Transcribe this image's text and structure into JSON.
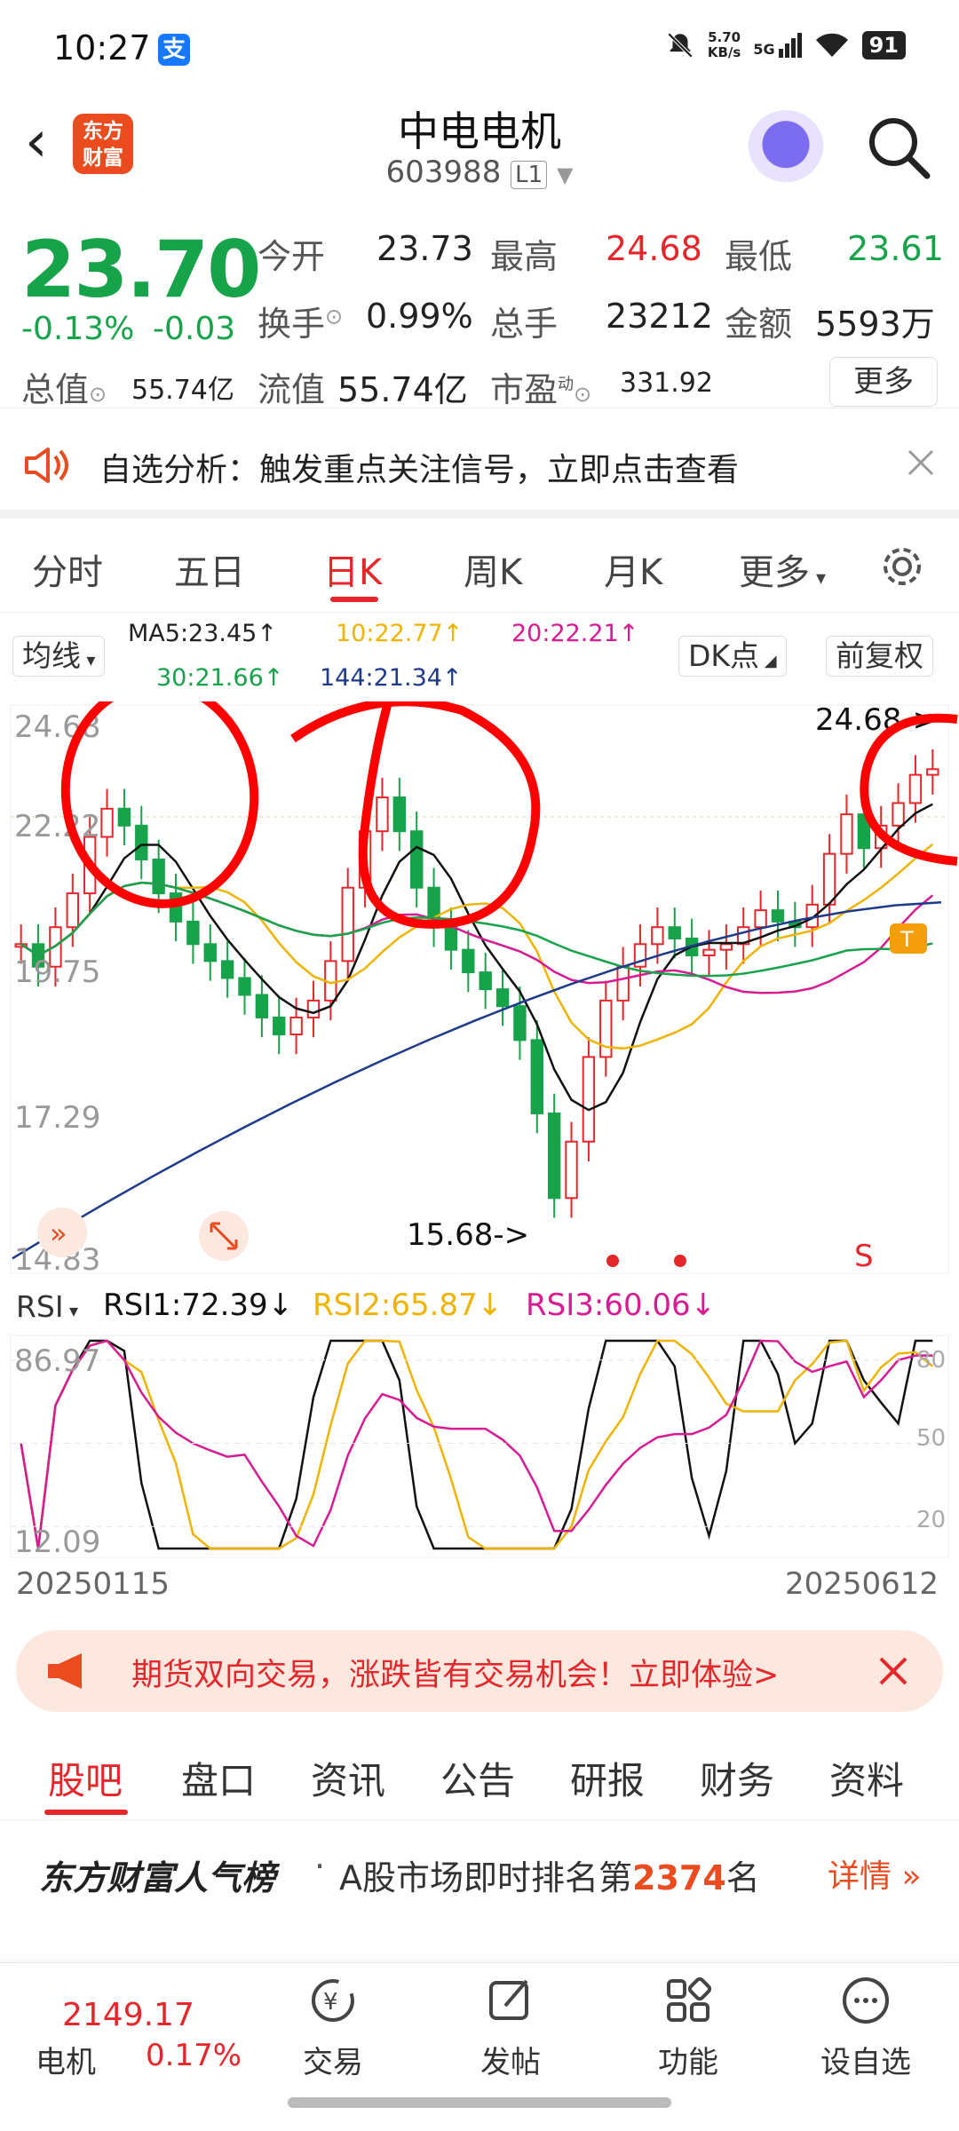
{
  "status_bar": {
    "time": "10:27",
    "alipay_icon": "支",
    "speed_value": "5.70",
    "speed_unit": "KB/s",
    "network": "5G",
    "battery": "91"
  },
  "header": {
    "logo_line1": "东方",
    "logo_line2": "财富",
    "stock_name": "中电电机",
    "stock_code": "603988",
    "level_badge": "L1"
  },
  "quote": {
    "price": "23.70",
    "change_pct": "-0.13%",
    "change_abs": "-0.03",
    "open_label": "今开",
    "open": "23.73",
    "high_label": "最高",
    "high": "24.68",
    "low_label": "最低",
    "low": "23.61",
    "turnover_label": "换手",
    "turnover": "0.99%",
    "volume_label": "总手",
    "volume": "23212",
    "amount_label": "金额",
    "amount": "5593万",
    "mktcap_label": "总值",
    "mktcap": "55.74亿",
    "float_label": "流值",
    "float_cap": "55.74亿",
    "pe_label": "市盈",
    "pe_sup": "动",
    "pe": "331.92",
    "more_button": "更多"
  },
  "banner": {
    "text": "自选分析：触发重点关注信号，立即点击查看"
  },
  "chart_tabs": [
    "分时",
    "五日",
    "日K",
    "周K",
    "月K",
    "更多"
  ],
  "chart_controls": {
    "ma_button": "均线",
    "ma5": "MA5:23.45↑",
    "ma10": "10:22.77↑",
    "ma20": "20:22.21↑",
    "ma30": "30:21.66↑",
    "ma144": "144:21.34↑",
    "dk_button": "DK点",
    "adjust_button": "前复权"
  },
  "kline_axis": {
    "y_labels": [
      "24.68",
      "22.22",
      "19.75",
      "17.29",
      "14.83"
    ],
    "high_marker": "24.68->",
    "low_marker": "15.68->",
    "signal": "S",
    "trade_badge": "T"
  },
  "rsi": {
    "selector": "RSI",
    "rsi1": "RSI1:72.39↓",
    "rsi2": "RSI2:65.87↓",
    "rsi3": "RSI3:60.06↓",
    "y_top": "86.97",
    "y_bottom": "12.09",
    "lvl80": "80",
    "lvl50": "50",
    "lvl20": "20"
  },
  "date_range": {
    "start": "20250115",
    "end": "20250612"
  },
  "ad": {
    "text": "期货双向交易，涨跌皆有交易机会！立即体验>"
  },
  "bottom_tabs": [
    "股吧",
    "盘口",
    "资讯",
    "公告",
    "研报",
    "财务",
    "资料"
  ],
  "rank": {
    "brand": "东方财富人气榜",
    "dot": "·",
    "prefix": "A股市场即时排名第",
    "number": "2374",
    "suffix": "名",
    "detail": "详情"
  },
  "bottom_nav": {
    "index_value": "2149.17",
    "index_name": "电机",
    "index_change": "0.17%",
    "trade": "交易",
    "post": "发帖",
    "functions": "功能",
    "add_watch": "设自选"
  },
  "chart_data": {
    "type": "candlestick",
    "x_start": "20250115",
    "x_end": "20250612",
    "y_range": [
      14.83,
      24.68
    ],
    "max_marked": 24.68,
    "min_marked": 15.68,
    "ma_latest": {
      "MA5": 23.45,
      "MA10": 22.77,
      "MA20": 22.21,
      "MA30": 21.66,
      "MA144": 21.34
    },
    "close_approx": [
      20.6,
      20.2,
      20.9,
      21.5,
      22.5,
      23.0,
      22.7,
      22.1,
      21.5,
      21.0,
      20.6,
      20.3,
      20.0,
      19.7,
      19.3,
      19.0,
      19.3,
      19.6,
      20.3,
      21.6,
      22.6,
      23.2,
      22.6,
      21.6,
      20.9,
      20.5,
      20.1,
      19.8,
      19.5,
      18.9,
      17.6,
      16.1,
      17.1,
      18.6,
      19.6,
      20.2,
      20.6,
      20.9,
      20.7,
      20.4,
      20.5,
      20.6,
      20.9,
      21.2,
      21.0,
      20.9,
      21.3,
      22.2,
      22.9,
      22.3,
      22.7,
      23.1,
      23.6,
      23.7
    ],
    "rsi": {
      "RSI1": 72.39,
      "RSI2": 65.87,
      "RSI3": 60.06,
      "y_range": [
        12.09,
        86.97
      ],
      "levels": [
        80,
        50,
        20
      ]
    }
  }
}
